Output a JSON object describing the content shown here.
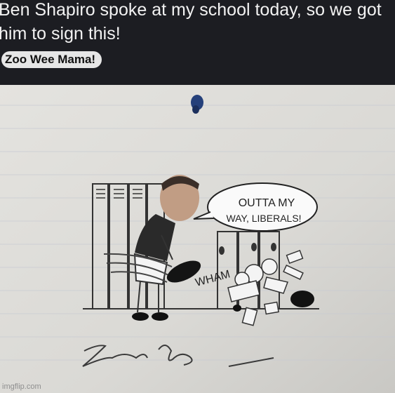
{
  "post": {
    "title": "Ben Shapiro spoke at my school today, so we got him to sign this!",
    "flair": "Zoo Wee Mama!"
  },
  "photo": {
    "speech_bubble": {
      "line1": "OUTTA MY",
      "line2": "WAY, LIBERALS!"
    },
    "sound_effect": "WHAM",
    "signature": "signature"
  },
  "footer": {
    "watermark": "imgflip.com"
  }
}
